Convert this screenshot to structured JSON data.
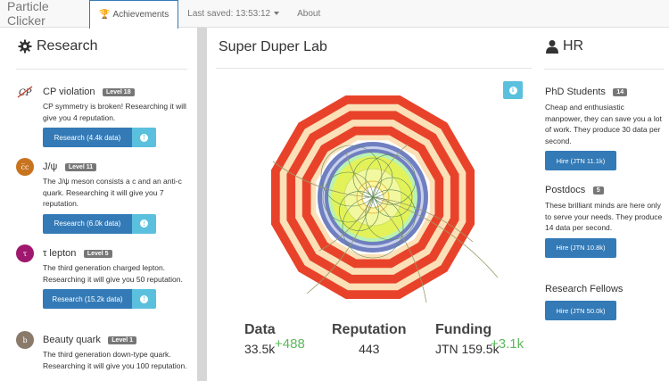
{
  "navbar": {
    "brand": "Particle Clicker",
    "achievements_label": "Achievements",
    "last_saved_label": "Last saved: 13:53:12",
    "about_label": "About"
  },
  "research": {
    "title": "Research",
    "items": [
      {
        "name": "CP violation",
        "level": "Level 18",
        "description": "CP symmetry is broken! Researching it will give you 4 reputation.",
        "button_label": "Research (4.4k data)",
        "icon": "cp-violation-icon",
        "icon_text": "CP",
        "icon_color": "#ffffff"
      },
      {
        "name": "J/ψ",
        "level": "Level 11",
        "description": "The J/ψ meson consists a c and an anti-c quark. Researching it will give you 7 reputation.",
        "button_label": "Research (6.0k data)",
        "icon": "j-psi-icon",
        "icon_text": "c̅c",
        "icon_color": "#c8731e"
      },
      {
        "name": "τ lepton",
        "level": "Level 5",
        "description": "The third generation charged lepton. Researching it will give you 50 reputation.",
        "button_label": "Research (15.2k data)",
        "icon": "tau-lepton-icon",
        "icon_text": "τ",
        "icon_color": "#a0176e"
      },
      {
        "name": "Beauty quark",
        "level": "Level 1",
        "description": "The third generation down-type quark. Researching it will give you 100 reputation.",
        "icon": "beauty-quark-icon",
        "icon_text": "b",
        "icon_color": "#8a7a6a"
      }
    ]
  },
  "lab": {
    "title": "Super Duper Lab",
    "stats": {
      "data_label": "Data",
      "data_value": "33.5k",
      "data_delta": "+488",
      "reputation_label": "Reputation",
      "reputation_value": "443",
      "funding_label": "Funding",
      "funding_value": "JTN 159.5k",
      "funding_delta": "+3.1k"
    },
    "colors": {
      "outer_ring": "#e8432a",
      "cream": "#fbe0b8",
      "blue_ring": "#6f7fc0",
      "lime": "#e4f25a",
      "delta": "#5cb85c"
    }
  },
  "hr": {
    "title": "HR",
    "items": [
      {
        "name": "PhD Students",
        "count": "14",
        "description": "Cheap and enthusiastic manpower, they can save you a lot of work. They produce 30 data per second.",
        "button_label": "Hire (JTN 11.1k)"
      },
      {
        "name": "Postdocs",
        "count": "5",
        "description": "These brilliant minds are here only to serve your needs. They produce 14 data per second.",
        "button_label": "Hire (JTN 10.8k)"
      },
      {
        "name": "Research Fellows",
        "button_label": "Hire (JTN 50.0k)"
      }
    ]
  }
}
